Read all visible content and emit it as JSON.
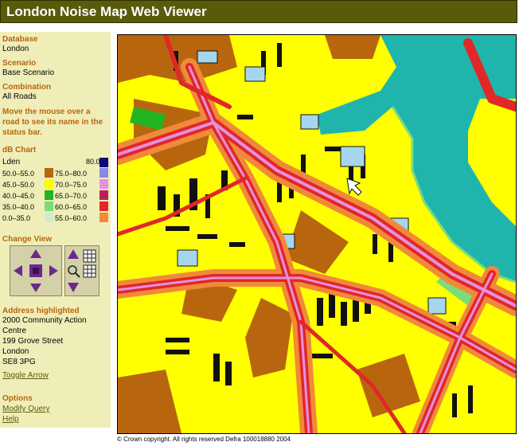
{
  "app": {
    "title": "London Noise Map Web Viewer"
  },
  "sidebar": {
    "database_label": "Database",
    "database_value": "London",
    "scenario_label": "Scenario",
    "scenario_value": "Base Scenario",
    "combination_label": "Combination",
    "combination_value": "All Roads",
    "hint": "Move the mouse over a road to see its name in the status bar.",
    "chart_label": "dB Chart",
    "chart_metric": "Lden",
    "legend_left": [
      {
        "range": "50.0–55.0",
        "color": "#b8660e"
      },
      {
        "range": "45.0–50.0",
        "color": "#ffff00"
      },
      {
        "range": "40.0–45.0",
        "color": "#22b422"
      },
      {
        "range": "35.0–40.0",
        "color": "#7adc7a"
      },
      {
        "range": "0.0–35.0",
        "color": "#cdeecd"
      }
    ],
    "legend_right": [
      {
        "range": "80.0–",
        "color": "#0a0a80"
      },
      {
        "range": "75.0–80.0",
        "color": "#8a88e8"
      },
      {
        "range": "70.0–75.0",
        "color": "#e690e0"
      },
      {
        "range": "65.0–70.0",
        "color": "#b8205a"
      },
      {
        "range": "60.0–65.0",
        "color": "#e02828"
      },
      {
        "range": "55.0–60.0",
        "color": "#f08a3a"
      }
    ],
    "change_view_label": "Change View",
    "address_label": "Address highlighted",
    "address_lines": [
      "2000 Community Action",
      "Centre",
      "199 Grove Street",
      "London",
      "SE8 3PG"
    ],
    "toggle_arrow": "Toggle Arrow",
    "options_label": "Options",
    "modify_query": "Modify Query",
    "help": "Help"
  },
  "footer": {
    "copyright": "© Crown copyright. All rights reserved Defra 100018880 2004"
  },
  "icons": [
    "pan-up-icon",
    "pan-down-icon",
    "pan-left-icon",
    "pan-right-icon",
    "center-icon",
    "zoom-in-icon",
    "zoom-out-icon",
    "magnifier-icon",
    "grid-icon"
  ]
}
